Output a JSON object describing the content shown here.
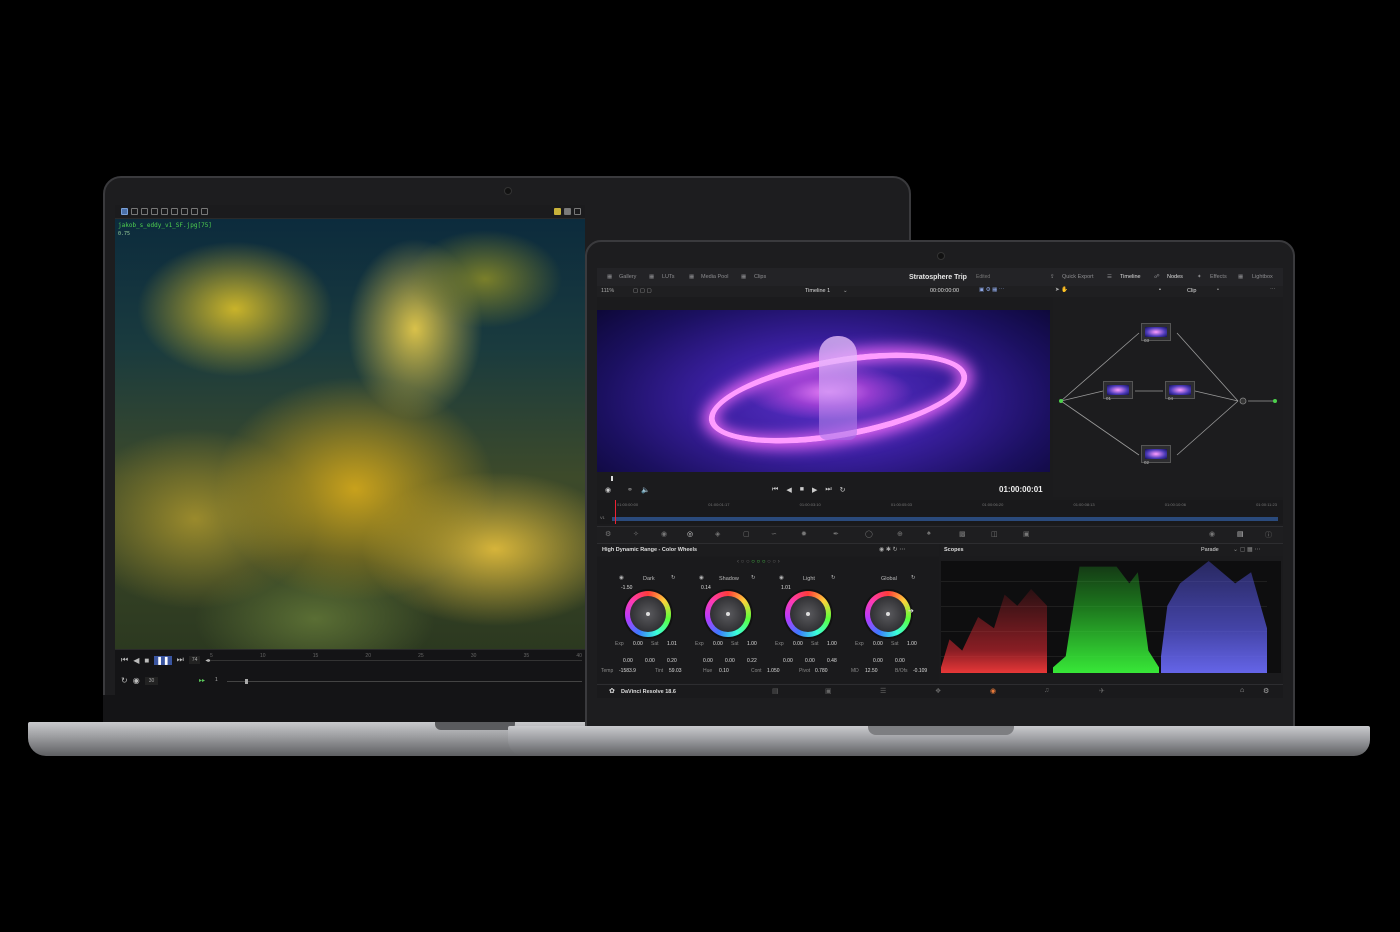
{
  "left_app": {
    "overlay_file": "jakob_s_eddy_v1_SF.jpg[75]",
    "overlay_sub": "0.75",
    "frame_counter": "74",
    "frame_field": "1",
    "fps_field": "30",
    "ruler": [
      "5",
      "10",
      "15",
      "20",
      "25",
      "30",
      "35",
      "40"
    ]
  },
  "right_app": {
    "nav": [
      "Gallery",
      "LUTs",
      "Media Pool",
      "Clips"
    ],
    "project_title": "Stratosphere Trip",
    "project_status": "Edited",
    "right_nav": [
      "Quick Export",
      "Timeline",
      "Nodes",
      "Effects",
      "Lightbox"
    ],
    "zoom": "111%",
    "timeline_name": "Timeline 1",
    "timecode_top": "00:00:00:00",
    "clip_mode": "Clip",
    "timecode_main": "01:00:00:01",
    "ruler": [
      "01:00:00:00",
      "01:00:01:17",
      "01:00:03:10",
      "01:00:05:03",
      "01:00:06:20",
      "01:00:08:13",
      "01:00:10:06",
      "01:00:11:23"
    ],
    "track_label": "V1",
    "nodes": [
      {
        "label": "03"
      },
      {
        "label": "01"
      },
      {
        "label": "04"
      },
      {
        "label": "02"
      }
    ],
    "panel_title": "High Dynamic Range - Color Wheels",
    "scopes_title": "Scopes",
    "scopes_mode": "Parade",
    "wheels": [
      {
        "name": "Dark",
        "top": "-1.50",
        "exp": "0.00",
        "sat": "1.01",
        "x": "0.00",
        "y": "0.00",
        "z": "0.20"
      },
      {
        "name": "Shadow",
        "top": "0.14",
        "exp": "0.00",
        "sat": "1.00",
        "x": "0.00",
        "y": "0.00",
        "z": "0.22"
      },
      {
        "name": "Light",
        "top": "1.01",
        "exp": "0.00",
        "sat": "1.00",
        "x": "0.00",
        "y": "0.00",
        "z": "0.48"
      },
      {
        "name": "Global",
        "top": "",
        "exp": "0.00",
        "sat": "1.00",
        "x": "0.00",
        "y": "0.00",
        "z": ""
      }
    ],
    "params": {
      "temp_label": "Temp",
      "temp": "-1583.9",
      "tint_label": "Tint",
      "tint": "59.03",
      "hue_label": "Hue",
      "hue": "0.10",
      "cont_label": "Cont",
      "cont": "1.050",
      "pivot_label": "Pivot",
      "pivot": "0.780",
      "md_label": "MD",
      "md": "12.50",
      "bofs_label": "B/Ofs",
      "bofs": "-0.109"
    },
    "exp_label": "Exp",
    "sat_label": "Sat",
    "brand": "DaVinci Resolve 18.6"
  }
}
